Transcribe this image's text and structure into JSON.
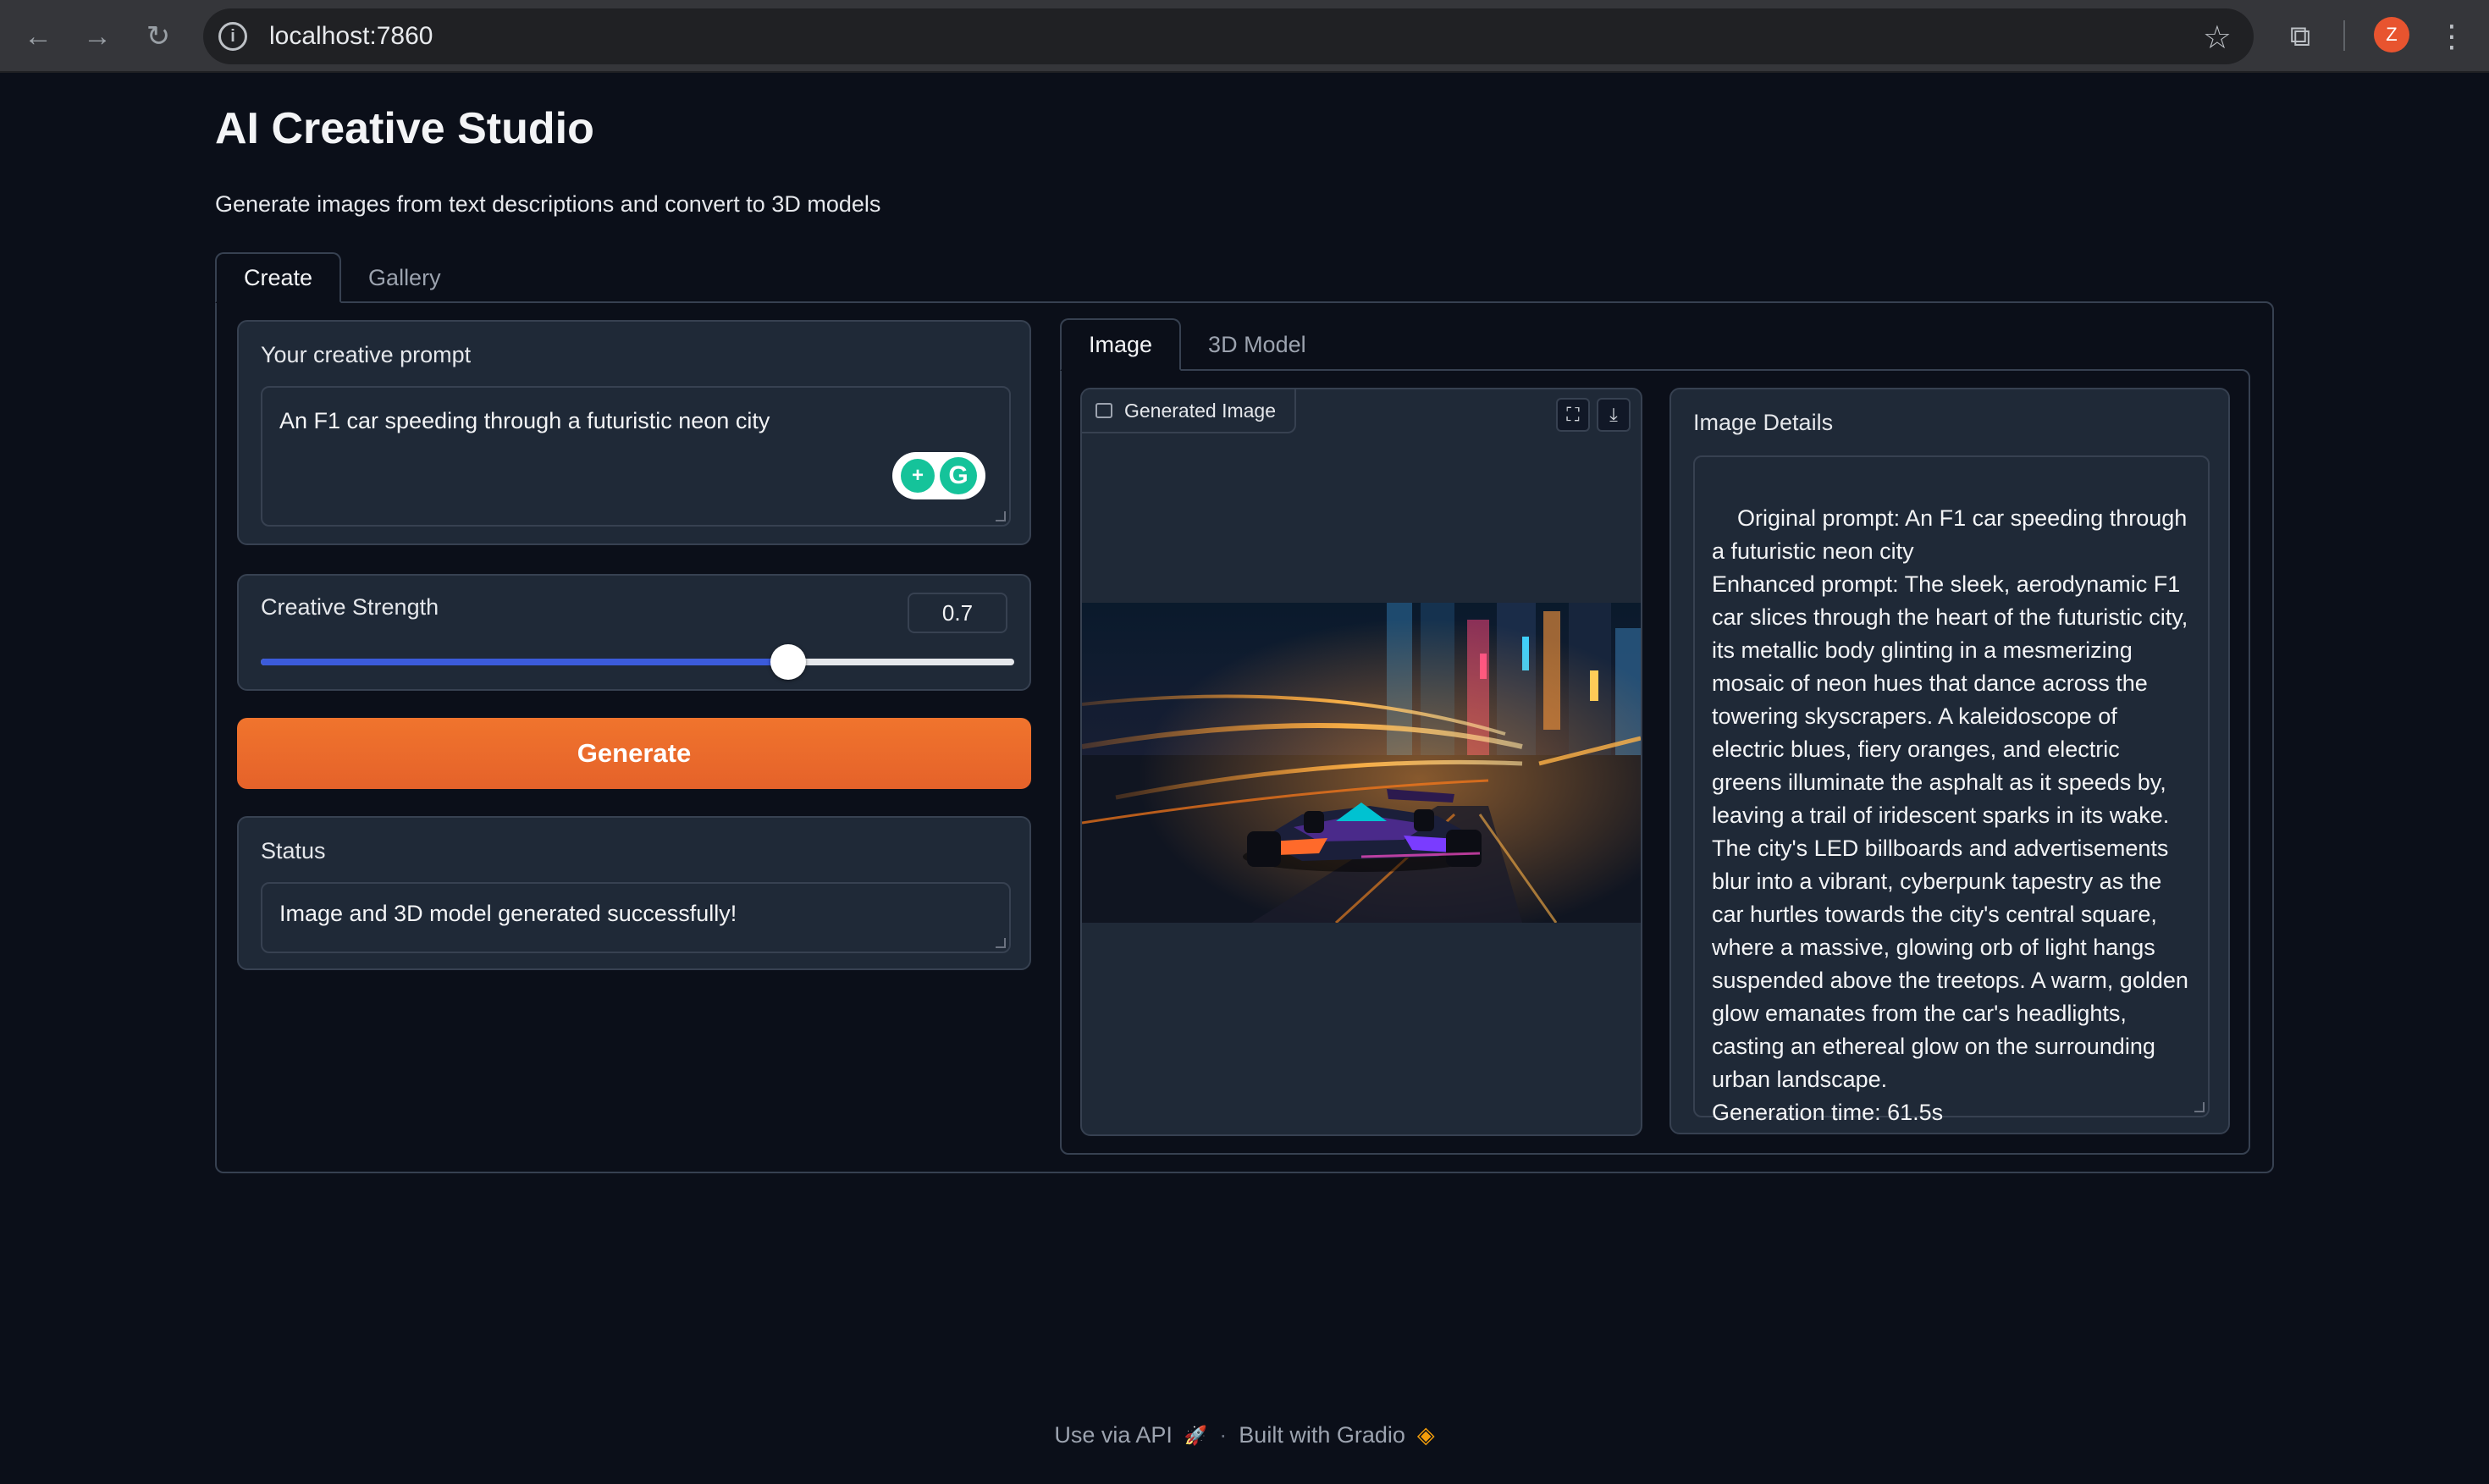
{
  "browser": {
    "url": "localhost:7860",
    "avatar_letter": "Z",
    "back_icon": "←",
    "forward_icon": "→",
    "reload_icon": "↻",
    "star_icon": "☆",
    "extensions_icon": "⧉",
    "menu_icon": "⋮"
  },
  "app": {
    "title": "AI Creative Studio",
    "subtitle": "Generate images from text descriptions and convert to 3D models",
    "tabs": [
      {
        "label": "Create",
        "active": true
      },
      {
        "label": "Gallery",
        "active": false
      }
    ]
  },
  "left": {
    "prompt_label": "Your creative prompt",
    "prompt_value": "An F1 car speeding through a futuristic neon city",
    "strength_label": "Creative Strength",
    "strength_value": "0.7",
    "strength_fraction": 0.7,
    "generate_label": "Generate",
    "status_label": "Status",
    "status_value": "Image and 3D model generated successfully!"
  },
  "right": {
    "tabs": [
      {
        "label": "Image",
        "active": true
      },
      {
        "label": "3D Model",
        "active": false
      }
    ],
    "image_label": "Generated Image",
    "details_label": "Image Details",
    "details_text": "Original prompt: An F1 car speeding through a futuristic neon city\nEnhanced prompt: The sleek, aerodynamic F1 car slices through the heart of the futuristic city, its metallic body glinting in a mesmerizing mosaic of neon hues that dance across the towering skyscrapers. A kaleidoscope of electric blues, fiery oranges, and electric greens illuminate the asphalt as it speeds by, leaving a trail of iridescent sparks in its wake. The city's LED billboards and advertisements blur into a vibrant, cyberpunk tapestry as the car hurtles towards the city's central square, where a massive, glowing orb of light hangs suspended above the treetops. A warm, golden glow emanates from the car's headlights, casting an ethereal glow on the surrounding urban landscape.\nGeneration time: 61.5s"
  },
  "footer": {
    "api_label": "Use via API",
    "api_icon": "🚀",
    "separator": "·",
    "built_label": "Built with Gradio",
    "gradio_icon": "◈"
  },
  "colors": {
    "background": "#0b0f19",
    "block": "#1f2937",
    "border": "#374151",
    "accent_orange": "#f0742d",
    "slider_blue": "#3b5bdb"
  }
}
